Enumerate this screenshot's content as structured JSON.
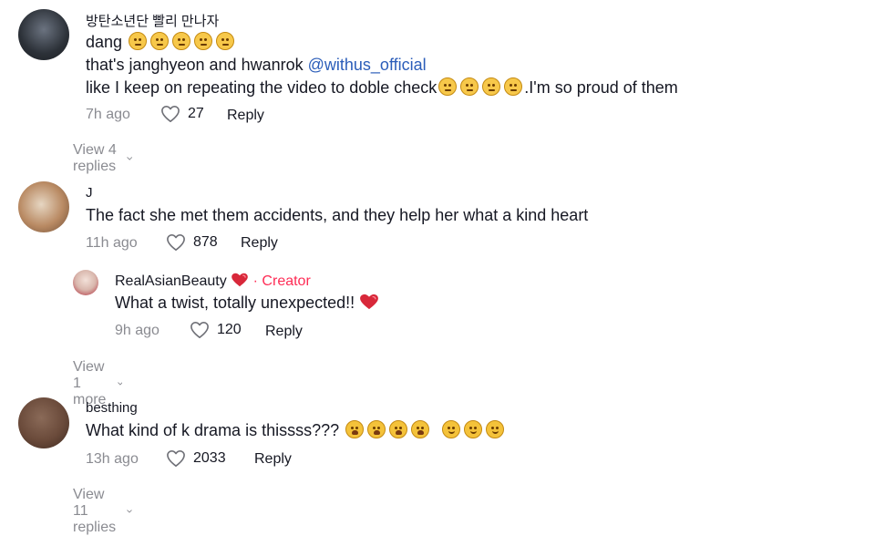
{
  "comments": [
    {
      "username": "방탄소년단 빨리 만나자",
      "lines": [
        "dang",
        "that's janghyeon and hwanrok",
        "like I keep on repeating the video to doble check",
        ".I'm so proud of them"
      ],
      "mention": "@withus_official",
      "time": "7h ago",
      "likes": "27",
      "reply_label": "Reply",
      "view_replies": "View 4 replies",
      "avatar_color": "#3a3f46"
    },
    {
      "username": "J",
      "lines": [
        "The fact she met them accidents, and they help her what a kind heart"
      ],
      "time": "11h ago",
      "likes": "878",
      "reply_label": "Reply",
      "avatar_color": "#b98a63",
      "reply": {
        "username": "RealAsianBeauty",
        "badge": "· Creator",
        "text": "What a twist, totally unexpected!!",
        "time": "9h ago",
        "likes": "120",
        "reply_label": "Reply",
        "avatar_color": "#d9b7ad"
      },
      "view_more": "View 1 more"
    },
    {
      "username": "besthing",
      "lines": [
        "What kind of k drama is thissss???"
      ],
      "time": "13h ago",
      "likes": "2033",
      "reply_label": "Reply",
      "view_replies": "View 11 replies",
      "avatar_color": "#6a4a3a"
    }
  ],
  "colors": {
    "meta": "#8a8b91",
    "mention": "#2b5db9",
    "creator": "#fe2c55"
  },
  "icons": [
    "heart-outline-icon",
    "chevron-down-icon",
    "red-heart-icon",
    "emoji-icon"
  ]
}
